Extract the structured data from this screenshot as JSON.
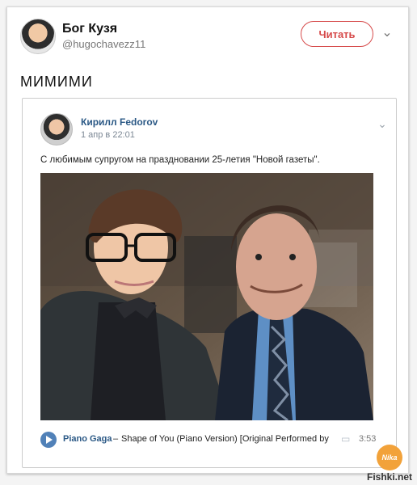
{
  "tweet": {
    "author_name": "Бог Кузя",
    "handle": "@hugochavezz11",
    "follow_label": "Читать",
    "text": "МИМИМИ"
  },
  "quoted_post": {
    "author_name": "Кирилл Fedorov",
    "date": "1 апр в 22:01",
    "text": "С любимым супругом на праздновании 25-летия \"Новой газеты\".",
    "photo_alt": "selfie"
  },
  "audio": {
    "artist": "Piano Gaga",
    "separator": "–",
    "title": "Shape of You (Piano Version) [Original Performed by Ed...",
    "duration": "3:53"
  },
  "watermark": {
    "badge": "Nika",
    "site": "Fishki.net"
  }
}
